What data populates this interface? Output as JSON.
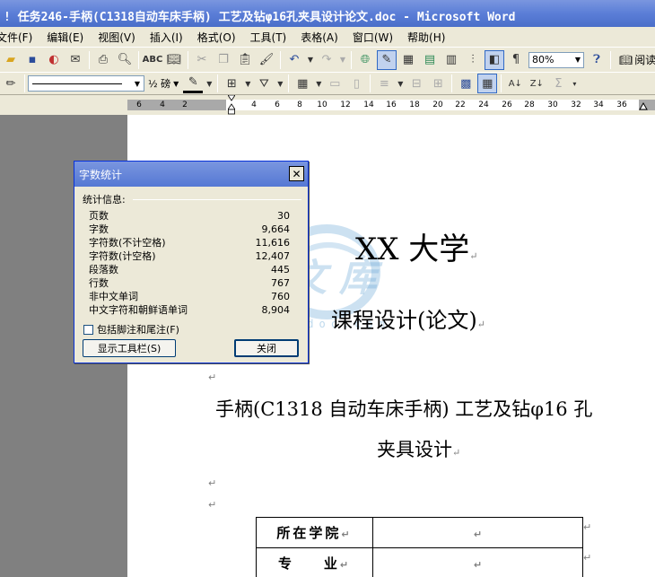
{
  "window": {
    "title": "! 任务246-手柄(C1318自动车床手柄) 工艺及钻φ16孔夹具设计论文.doc - Microsoft Word"
  },
  "menu": {
    "items": [
      "文件(F)",
      "编辑(E)",
      "视图(V)",
      "插入(I)",
      "格式(O)",
      "工具(T)",
      "表格(A)",
      "窗口(W)",
      "帮助(H)"
    ]
  },
  "toolbar": {
    "zoom": "80%",
    "read_label": "阅读",
    "line_weight": "½ 磅"
  },
  "ruler": {
    "left_numbers": [
      "6",
      "4",
      "2"
    ],
    "right_numbers": [
      "4",
      "6",
      "8",
      "10",
      "12",
      "14",
      "16",
      "18",
      "20",
      "22",
      "24",
      "26",
      "28",
      "30",
      "32",
      "34",
      "36"
    ]
  },
  "document": {
    "title": "XX 大学",
    "subtitle": "课程设计(论文)",
    "topic_line1": "手柄(C1318 自动车床手柄) 工艺及钻φ16 孔",
    "topic_line2": "夹具设计",
    "paragraph_mark": "↵",
    "table": [
      {
        "label": "所在学院",
        "value": ""
      },
      {
        "label": "专    业",
        "value": ""
      }
    ]
  },
  "watermark": {
    "text": "人人文库",
    "url": "www.renrendoc.com"
  },
  "dialog": {
    "title": "字数统计",
    "section_label": "统计信息:",
    "stats": [
      {
        "label": "页数",
        "value": "30"
      },
      {
        "label": "字数",
        "value": "9,664"
      },
      {
        "label": "字符数(不计空格)",
        "value": "11,616"
      },
      {
        "label": "字符数(计空格)",
        "value": "12,407"
      },
      {
        "label": "段落数",
        "value": "445"
      },
      {
        "label": "行数",
        "value": "767"
      },
      {
        "label": "非中文单词",
        "value": "760"
      },
      {
        "label": "中文字符和朝鲜语单词",
        "value": "8,904"
      }
    ],
    "checkbox_label": "包括脚注和尾注(F)",
    "show_toolbar_button": "显示工具栏(S)",
    "close_button": "关闭"
  }
}
